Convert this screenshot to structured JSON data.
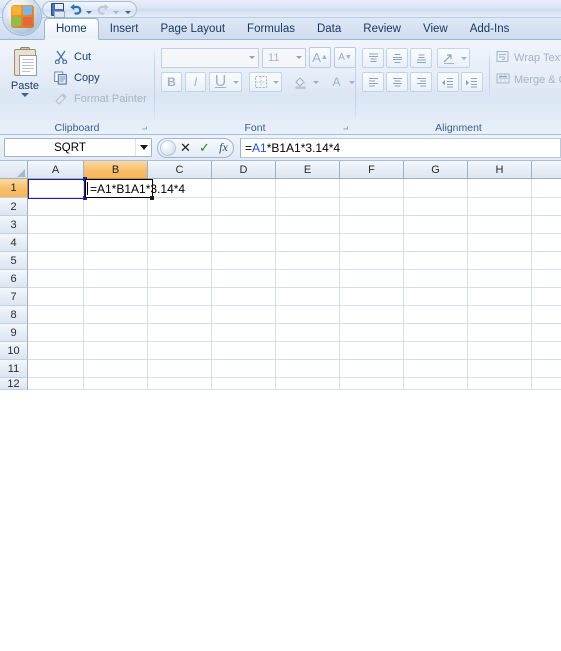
{
  "app": {
    "office_button": "office-logo",
    "quick_access": [
      {
        "name": "save",
        "label": "Save",
        "icon": "save-icon",
        "enabled": true,
        "has_dropdown": false
      },
      {
        "name": "undo",
        "label": "Undo",
        "icon": "undo-icon",
        "enabled": true,
        "has_dropdown": true
      },
      {
        "name": "redo",
        "label": "Redo",
        "icon": "redo-icon",
        "enabled": false,
        "has_dropdown": true
      },
      {
        "name": "customize",
        "label": "Customize Quick Access Toolbar",
        "icon": "chevron-down-icon",
        "enabled": true,
        "has_dropdown": false
      }
    ]
  },
  "ribbon": {
    "tabs": [
      {
        "label": "Home",
        "active": true
      },
      {
        "label": "Insert",
        "active": false
      },
      {
        "label": "Page Layout",
        "active": false
      },
      {
        "label": "Formulas",
        "active": false
      },
      {
        "label": "Data",
        "active": false
      },
      {
        "label": "Review",
        "active": false
      },
      {
        "label": "View",
        "active": false
      },
      {
        "label": "Add-Ins",
        "active": false
      }
    ],
    "groups": {
      "clipboard": {
        "label": "Clipboard",
        "paste": {
          "label": "Paste",
          "icon": "paste-clipboard-icon"
        },
        "items": [
          {
            "label": "Cut",
            "icon": "scissors-icon",
            "enabled": true
          },
          {
            "label": "Copy",
            "icon": "copy-icon",
            "enabled": true
          },
          {
            "label": "Format Painter",
            "icon": "paintbrush-icon",
            "enabled": false
          }
        ]
      },
      "font": {
        "label": "Font",
        "font_name": {
          "value": "",
          "placeholder": ""
        },
        "font_size": {
          "value": "11"
        },
        "grow_font": "A",
        "shrink_font": "A",
        "bold": "B",
        "italic": "I",
        "underline": "U",
        "borders": "borders-icon",
        "fill_color": "fill-color-icon",
        "font_color": "font-color-icon",
        "enabled": false
      },
      "alignment": {
        "label": "Alignment",
        "wrap_text": "Wrap Text",
        "merge_center": "Merge & C",
        "align_top": "align-top-icon",
        "align_middle": "align-middle-icon",
        "align_bottom": "align-bottom-icon",
        "orientation": "orientation-icon",
        "align_left": "align-left-icon",
        "align_center": "align-center-icon",
        "align_right": "align-right-icon",
        "decrease_indent": "decrease-indent-icon",
        "increase_indent": "increase-indent-icon",
        "enabled": false
      }
    }
  },
  "formula_bar": {
    "name_box": {
      "value": "SQRT"
    },
    "cancel_button": "✕",
    "enter_button": "✓",
    "insert_function_button": "fx",
    "formula": {
      "full": "=A1*B1A1*3.14*4",
      "prefix": "=",
      "reference": "A1",
      "suffix": "*B1A1*3.14*4"
    }
  },
  "sheet": {
    "columns": [
      "A",
      "B",
      "C",
      "D",
      "E",
      "F",
      "G",
      "H"
    ],
    "selected_column": "B",
    "rows": [
      "1",
      "2",
      "3",
      "4",
      "5",
      "6",
      "7",
      "8",
      "9",
      "10",
      "11",
      "12"
    ],
    "selected_row": "1",
    "active_cell": "B1",
    "editing": true,
    "cell_text": "=A1*B1A1*3.14*4",
    "reference_cell": "A1"
  },
  "colors": {
    "selection_orange": "#f7bf6b",
    "reference_blue": "#1f4fd8",
    "ribbon_blue": "#e4ecf7",
    "header_text": "#17375e",
    "gridline": "#d5dde8"
  }
}
